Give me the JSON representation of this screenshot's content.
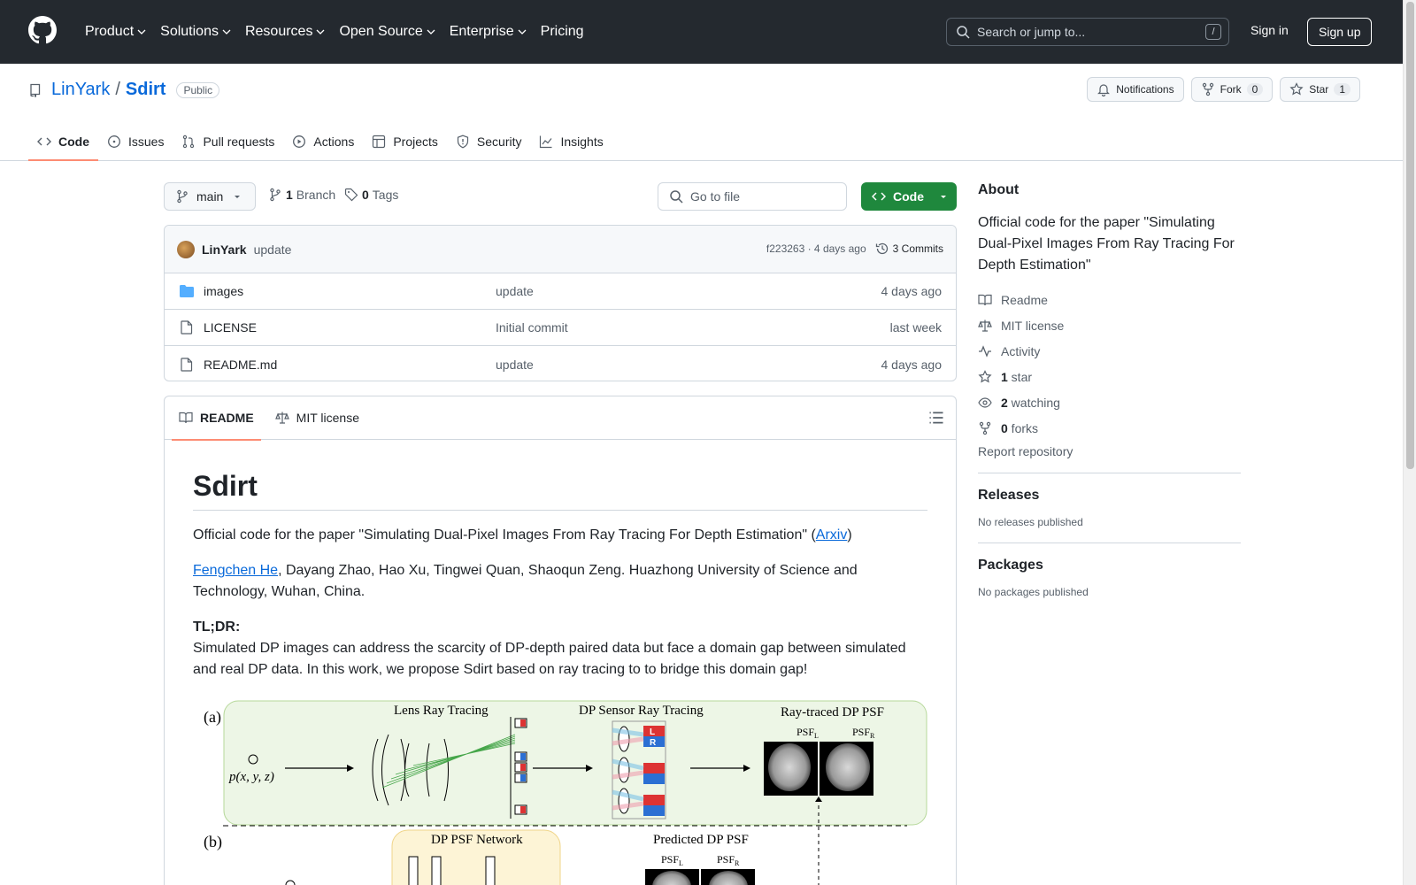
{
  "header": {
    "nav": [
      "Product",
      "Solutions",
      "Resources",
      "Open Source",
      "Enterprise",
      "Pricing"
    ],
    "search_placeholder": "Search or jump to...",
    "search_shortcut": "/",
    "signin": "Sign in",
    "signup": "Sign up"
  },
  "repo": {
    "owner": "LinYark",
    "separator": "/",
    "name": "Sdirt",
    "visibility": "Public",
    "notifications": "Notifications",
    "fork_label": "Fork",
    "fork_count": "0",
    "star_label": "Star",
    "star_count": "1",
    "tabs": [
      "Code",
      "Issues",
      "Pull requests",
      "Actions",
      "Projects",
      "Security",
      "Insights"
    ]
  },
  "toolbar": {
    "branch": "main",
    "branches_count": "1",
    "branches_label": "Branch",
    "tags_count": "0",
    "tags_label": "Tags",
    "goto_placeholder": "Go to file",
    "code_button": "Code"
  },
  "commit": {
    "author": "LinYark",
    "message": "update",
    "hash_time": "f223263 · 4 days ago",
    "commits_count": "3 Commits"
  },
  "files": [
    {
      "name": "images",
      "type": "folder",
      "message": "update",
      "date": "4 days ago"
    },
    {
      "name": "LICENSE",
      "type": "file",
      "message": "Initial commit",
      "date": "last week"
    },
    {
      "name": "README.md",
      "type": "file",
      "message": "update",
      "date": "4 days ago"
    }
  ],
  "readme": {
    "tabs": [
      "README",
      "MIT license"
    ],
    "title": "Sdirt",
    "intro": "Official code for the paper \"Simulating Dual-Pixel Images From Ray Tracing For Depth Estimation\" (",
    "intro_link": "Arxiv",
    "intro_close": ")",
    "author_link": "Fengchen He",
    "authors_rest": ", Dayang Zhao, Hao Xu, Tingwei Quan, Shaoqun Zeng. Huazhong University of Science and Technology, Wuhan, China.",
    "tldr_label": "TL;DR:",
    "tldr_text": "Simulated DP images can address the scarcity of DP-depth paired data but face a domain gap between simulated and real DP data. In this work, we propose Sdirt based on ray tracing to to bridge this domain gap!",
    "figure": {
      "label_a": "(a)",
      "label_b": "(b)",
      "lens_ray_tracing": "Lens Ray Tracing",
      "dp_sensor_ray_tracing": "DP Sensor Ray Tracing",
      "ray_traced_psf": "Ray-traced DP PSF",
      "psf_l": "PSF",
      "psf_r": "PSF",
      "sub_l": "L",
      "sub_r": "R",
      "point": "p(x, y, z)",
      "dp_psf_network": "DP PSF Network",
      "predicted_psf": "Predicted DP PSF",
      "pixel_l": "L",
      "pixel_r": "R"
    }
  },
  "sidebar": {
    "about_title": "About",
    "description": "Official code for the paper \"Simulating Dual-Pixel Images From Ray Tracing For Depth Estimation\"",
    "items": [
      {
        "icon": "book-icon",
        "label": "Readme",
        "bold": ""
      },
      {
        "icon": "law-icon",
        "label": "MIT license",
        "bold": ""
      },
      {
        "icon": "pulse-icon",
        "label": "Activity",
        "bold": ""
      },
      {
        "icon": "star-icon",
        "label": " star",
        "bold": "1"
      },
      {
        "icon": "eye-icon",
        "label": " watching",
        "bold": "2"
      },
      {
        "icon": "fork-icon",
        "label": " forks",
        "bold": "0"
      }
    ],
    "report": "Report repository",
    "releases_title": "Releases",
    "releases_text": "No releases published",
    "packages_title": "Packages",
    "packages_text": "No packages published"
  },
  "colors": {
    "header_bg": "#24292f",
    "link": "#0969da",
    "primary_button": "#1f883d",
    "tab_underline": "#fd8c73"
  }
}
